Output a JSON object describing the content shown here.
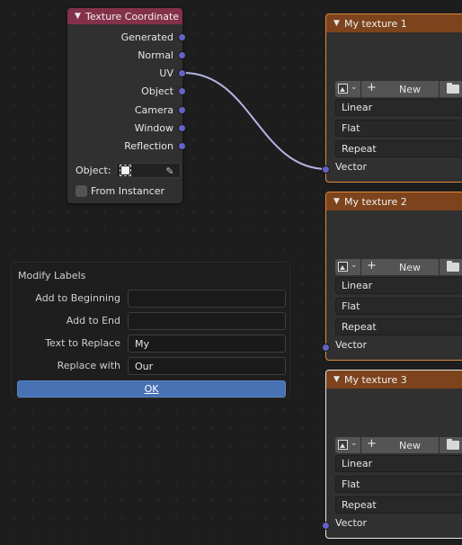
{
  "texture_coordinate": {
    "title": "Texture Coordinate",
    "outputs": [
      "Generated",
      "Normal",
      "UV",
      "Object",
      "Camera",
      "Window",
      "Reflection"
    ],
    "object_label": "Object:",
    "from_instancer_label": "From Instancer",
    "header_color": "#83314a",
    "socket_color": "#6363c7"
  },
  "modify_labels": {
    "title": "Modify Labels",
    "fields": [
      {
        "label": "Add to Beginning",
        "value": ""
      },
      {
        "label": "Add to End",
        "value": ""
      },
      {
        "label": "Text to Replace",
        "value": "My"
      },
      {
        "label": "Replace with",
        "value": "Our"
      }
    ],
    "ok_label": "OK",
    "ok_color": "#4772b3"
  },
  "image_textures": [
    {
      "title": "My texture 1",
      "new_label": "New",
      "interpolation": "Linear",
      "projection": "Flat",
      "extension": "Repeat",
      "input": "Vector",
      "selected": "active"
    },
    {
      "title": "My texture 2",
      "new_label": "New",
      "interpolation": "Linear",
      "projection": "Flat",
      "extension": "Repeat",
      "input": "Vector",
      "selected": "active"
    },
    {
      "title": "My texture 3",
      "new_label": "New",
      "interpolation": "Linear",
      "projection": "Flat",
      "extension": "Repeat",
      "input": "Vector",
      "selected": "highlight"
    }
  ],
  "colors": {
    "image_header": "#7d431c",
    "selection_orange": "#df8a3a",
    "link_color": "#b4b4e6"
  }
}
